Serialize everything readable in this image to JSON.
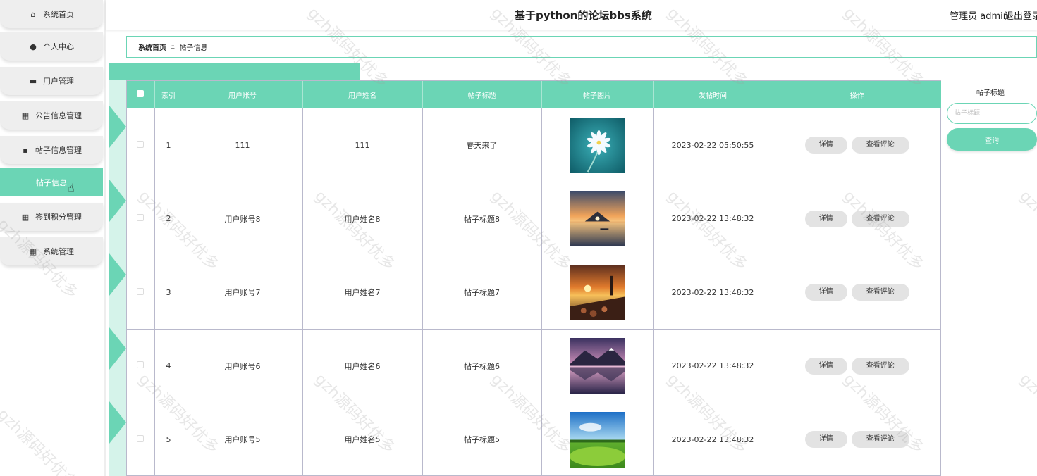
{
  "header": {
    "title": "基于python的论坛bbs系统",
    "user": "管理员 admin",
    "logout": "退出登录"
  },
  "sidebar": {
    "items": [
      {
        "label": "系统首页",
        "icon": "home-icon",
        "glyph": "⌂"
      },
      {
        "label": "个人中心",
        "icon": "user-icon",
        "glyph": "●"
      },
      {
        "label": "用户管理",
        "icon": "chat-icon",
        "glyph": "▬"
      },
      {
        "label": "公告信息管理",
        "icon": "grid-icon",
        "glyph": "▦"
      },
      {
        "label": "帖子信息管理",
        "icon": "folder-icon",
        "glyph": "▪"
      },
      {
        "label": "帖子信息",
        "icon": "",
        "glyph": "",
        "active": true
      },
      {
        "label": "签到积分管理",
        "icon": "grid-icon",
        "glyph": "▦"
      },
      {
        "label": "系统管理",
        "icon": "grid-icon",
        "glyph": "▦"
      }
    ]
  },
  "breadcrumb": {
    "home": "系统首页",
    "separator": "Ξ",
    "current": "帖子信息"
  },
  "table": {
    "columns": [
      "",
      "索引",
      "用户账号",
      "用户姓名",
      "帖子标题",
      "帖子图片",
      "发帖时间",
      "操作"
    ],
    "rows": [
      {
        "index": "1",
        "account": "111",
        "name": "111",
        "title": "春天来了",
        "image": "flower",
        "time": "2023-02-22 05:50:55"
      },
      {
        "index": "2",
        "account": "用户账号8",
        "name": "用户姓名8",
        "title": "帖子标题8",
        "image": "sunset-lake",
        "time": "2023-02-22 13:48:32"
      },
      {
        "index": "3",
        "account": "用户账号7",
        "name": "用户姓名7",
        "title": "帖子标题7",
        "image": "lighthouse",
        "time": "2023-02-22 13:48:32"
      },
      {
        "index": "4",
        "account": "用户账号6",
        "name": "用户姓名6",
        "title": "帖子标题6",
        "image": "mountain-lake",
        "time": "2023-02-22 13:48:32"
      },
      {
        "index": "5",
        "account": "用户账号5",
        "name": "用户姓名5",
        "title": "帖子标题5",
        "image": "green-field",
        "time": "2023-02-22 13:48:32"
      }
    ],
    "detail_label": "详情",
    "comment_label": "查看评论"
  },
  "search": {
    "label": "帖子标题",
    "placeholder": "帖子标题",
    "button": "查询"
  },
  "watermark": "gzh源码好优多",
  "colors": {
    "accent": "#6bd5b5",
    "accent_light": "#d5f3ea"
  }
}
